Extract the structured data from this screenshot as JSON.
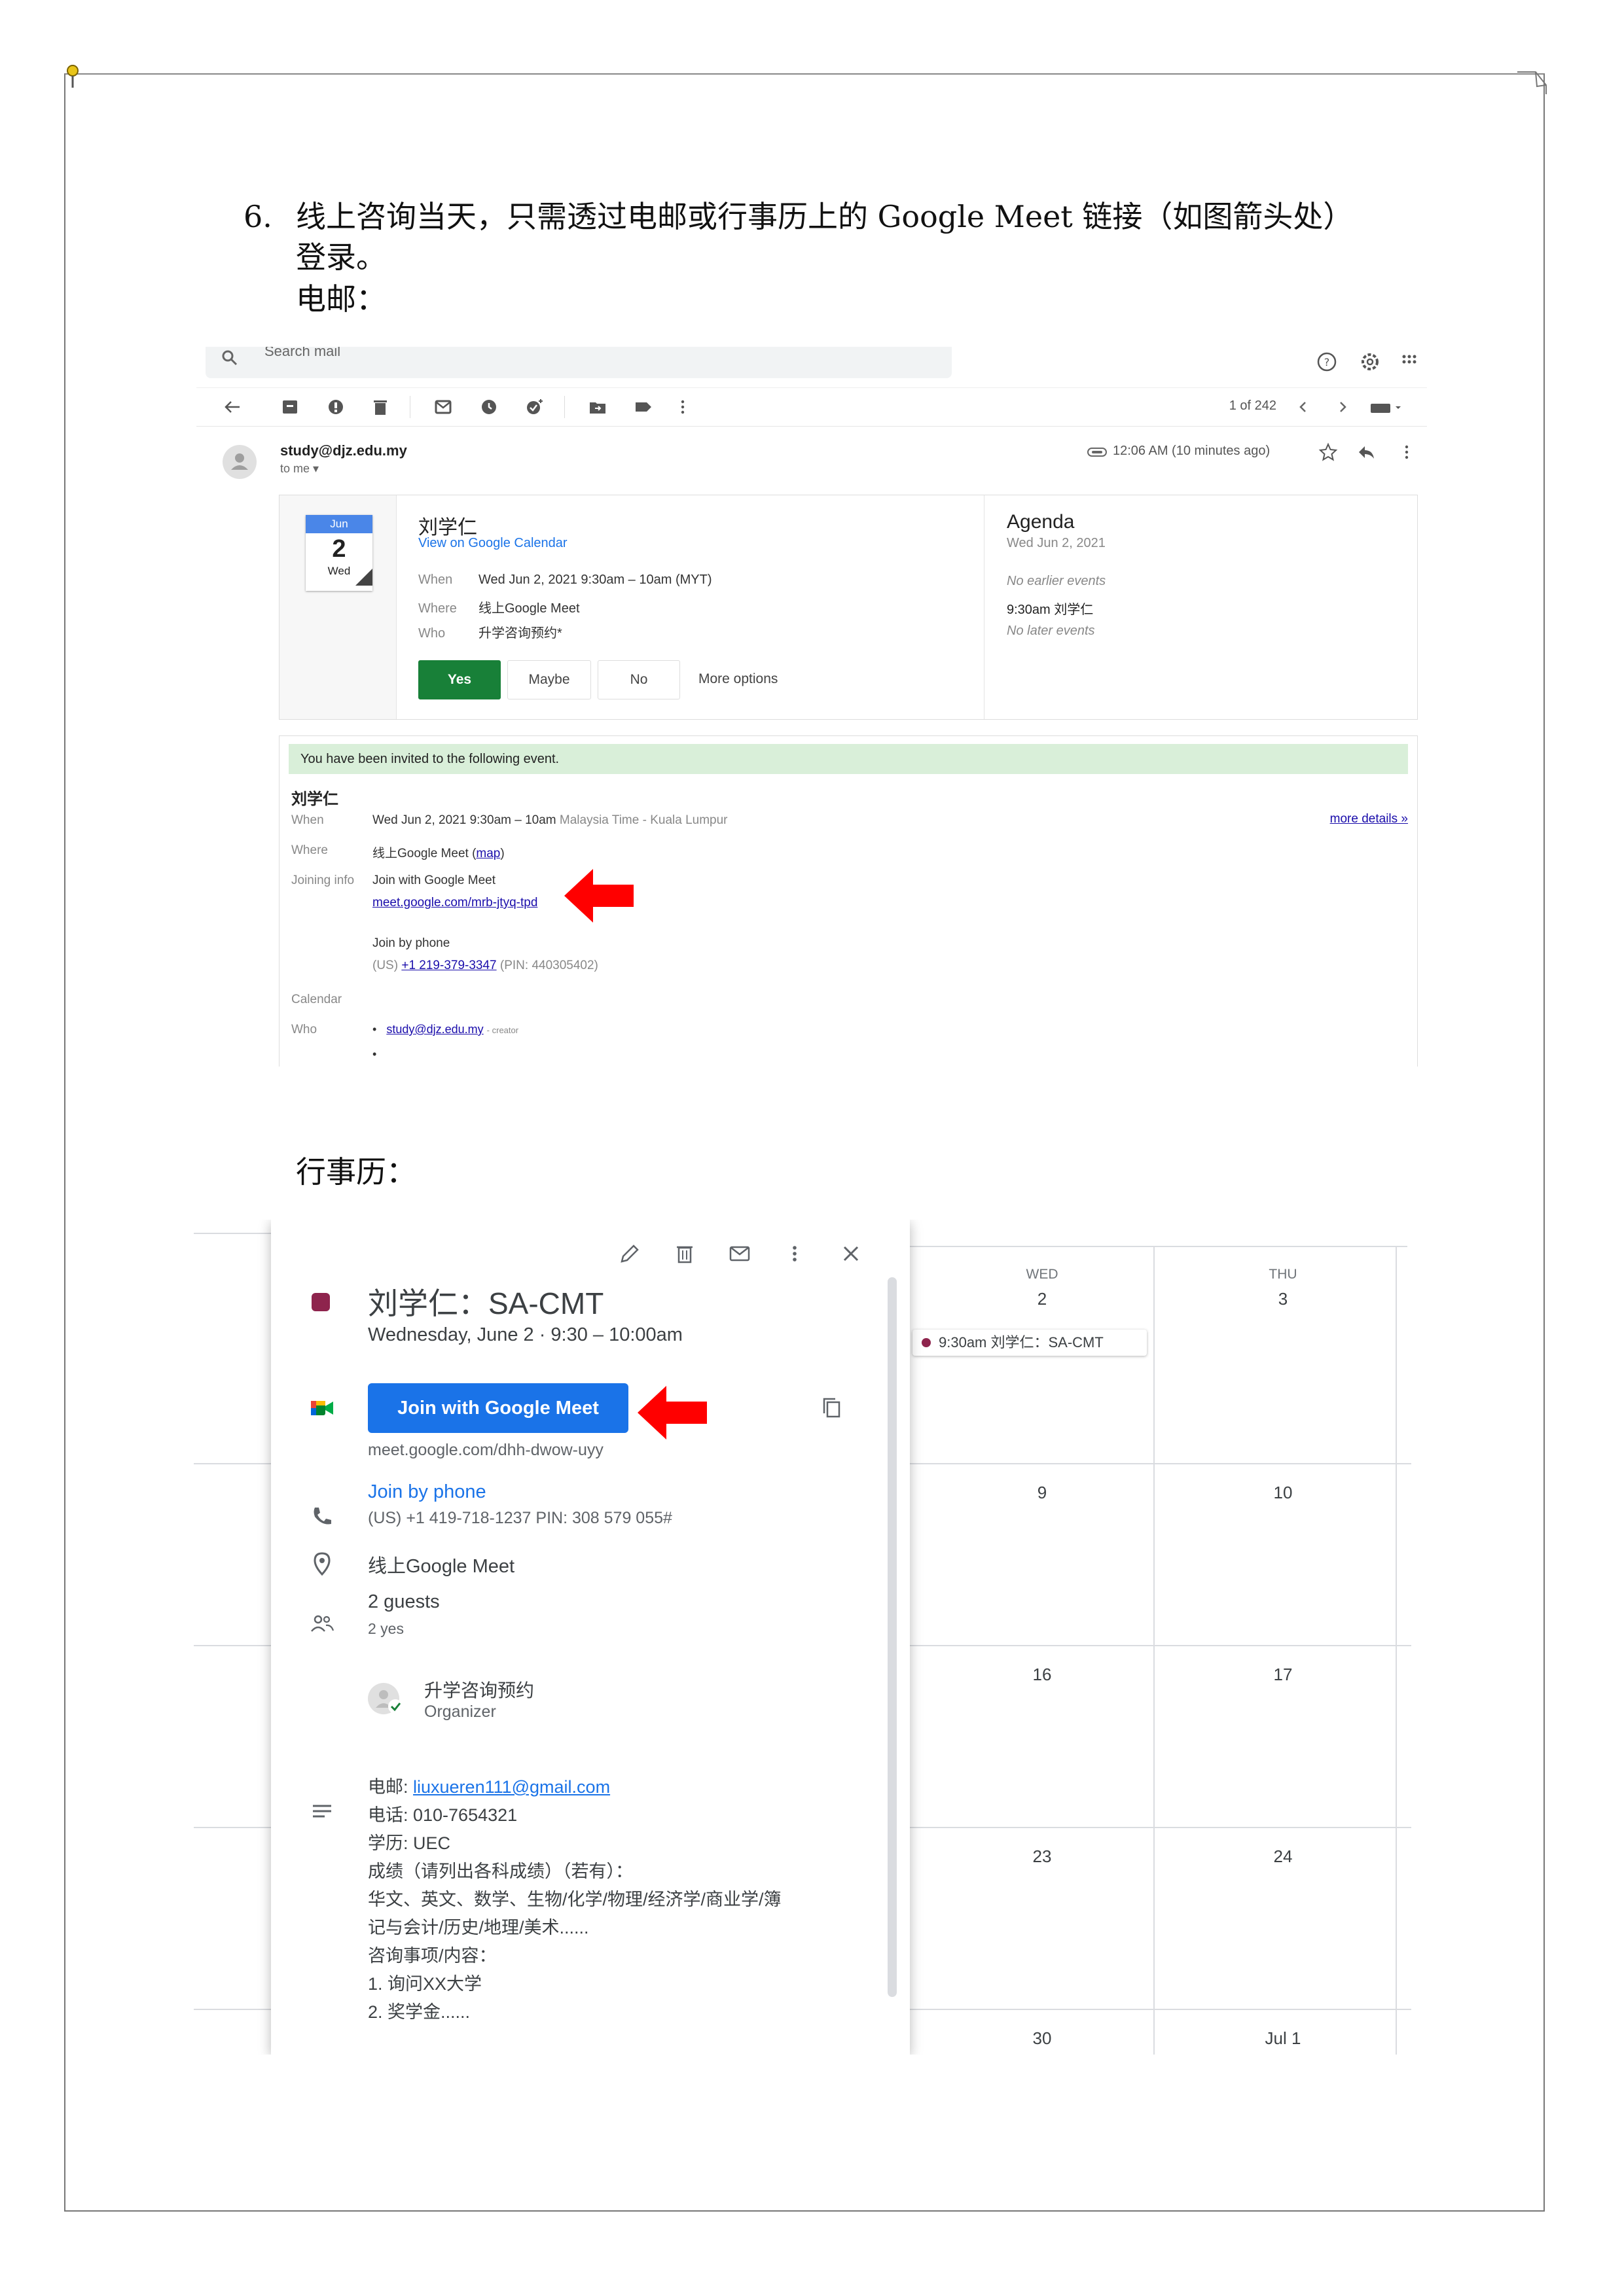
{
  "doc": {
    "step_number": "6.",
    "line1": "线上咨询当天，只需透过电邮或行事历上的 Google Meet 链接（如图箭头处）",
    "line2": "登录。",
    "email_heading": "电邮：",
    "calendar_heading": "行事历："
  },
  "gmail": {
    "search_placeholder": "Search mail",
    "pager": "1 of 242",
    "sender": "study@djz.edu.my",
    "to": "to me ▾",
    "time": "12:06 AM (10 minutes ago)",
    "card": {
      "month": "Jun",
      "day": "2",
      "weekday": "Wed",
      "title": "刘学仁",
      "view_link": "View on Google Calendar",
      "when_label": "When",
      "when": "Wed Jun 2, 2021 9:30am – 10am (MYT)",
      "where_label": "Where",
      "where": "线上Google Meet",
      "who_label": "Who",
      "who": "升学咨询预约*",
      "yes": "Yes",
      "maybe": "Maybe",
      "no": "No",
      "more_options": "More options"
    },
    "agenda": {
      "title": "Agenda",
      "date": "Wed Jun 2, 2021",
      "no_earlier": "No earlier events",
      "event": "9:30am   刘学仁",
      "no_later": "No later events"
    },
    "invite": {
      "banner": "You have been invited to the following event.",
      "title": "刘学仁",
      "when_label": "When",
      "when": "Wed Jun 2, 2021 9:30am – 10am",
      "when_tz": "Malaysia Time - Kuala Lumpur",
      "more_details": "more details »",
      "where_label": "Where",
      "where": "线上Google Meet",
      "map_link": "map",
      "joining_label": "Joining info",
      "join_meet": "Join with Google Meet",
      "meet_link": "meet.google.com/mrb-jtyq-tpd",
      "join_phone": "Join by phone",
      "phone_prefix": "(US)",
      "phone": "+1 219-379-3347",
      "pin": "(PIN: 440305402)",
      "calendar_label": "Calendar",
      "who_label": "Who",
      "creator_email": "study@djz.edu.my",
      "creator_tag": "- creator"
    }
  },
  "calendar": {
    "col_wed": "WED",
    "col_thu": "THU",
    "dates": [
      "2",
      "3",
      "9",
      "10",
      "16",
      "17",
      "23",
      "24",
      "30",
      "Jul 1"
    ],
    "chip": "9:30am 刘学仁：SA-CMT",
    "event_color": "#8e244d",
    "popup": {
      "title": "刘学仁：SA-CMT",
      "datetime": "Wednesday, June 2  ·  9:30 – 10:00am",
      "meet_button": "Join with Google Meet",
      "meet_url": "meet.google.com/dhh-dwow-uyy",
      "join_phone": "Join by phone",
      "phone_detail": "(US) +1 419-718-1237 PIN: 308 579 055#",
      "location": "线上Google Meet",
      "guests": "2 guests",
      "guests_yes": "2 yes",
      "organizer_name": "升学咨询预约",
      "organizer_role": "Organizer",
      "desc_email_label": "电邮: ",
      "desc_email": "liuxueren111@gmail.com",
      "desc_rest": "电话: 010-7654321\n学历: UEC\n成绩（请列出各科成绩）（若有）：\n华文、英文、数学、生物/化学/物理/经济学/商业学/簿\n记与会计/历史/地理/美术......\n咨询事项/内容：\n1. 询问XX大学\n2. 奖学金......"
    }
  },
  "colors": {
    "gmail_yes": "#188038",
    "banner": "#d9efd9",
    "meet_blue": "#1a73e8",
    "arrow_red": "#ff0000"
  }
}
